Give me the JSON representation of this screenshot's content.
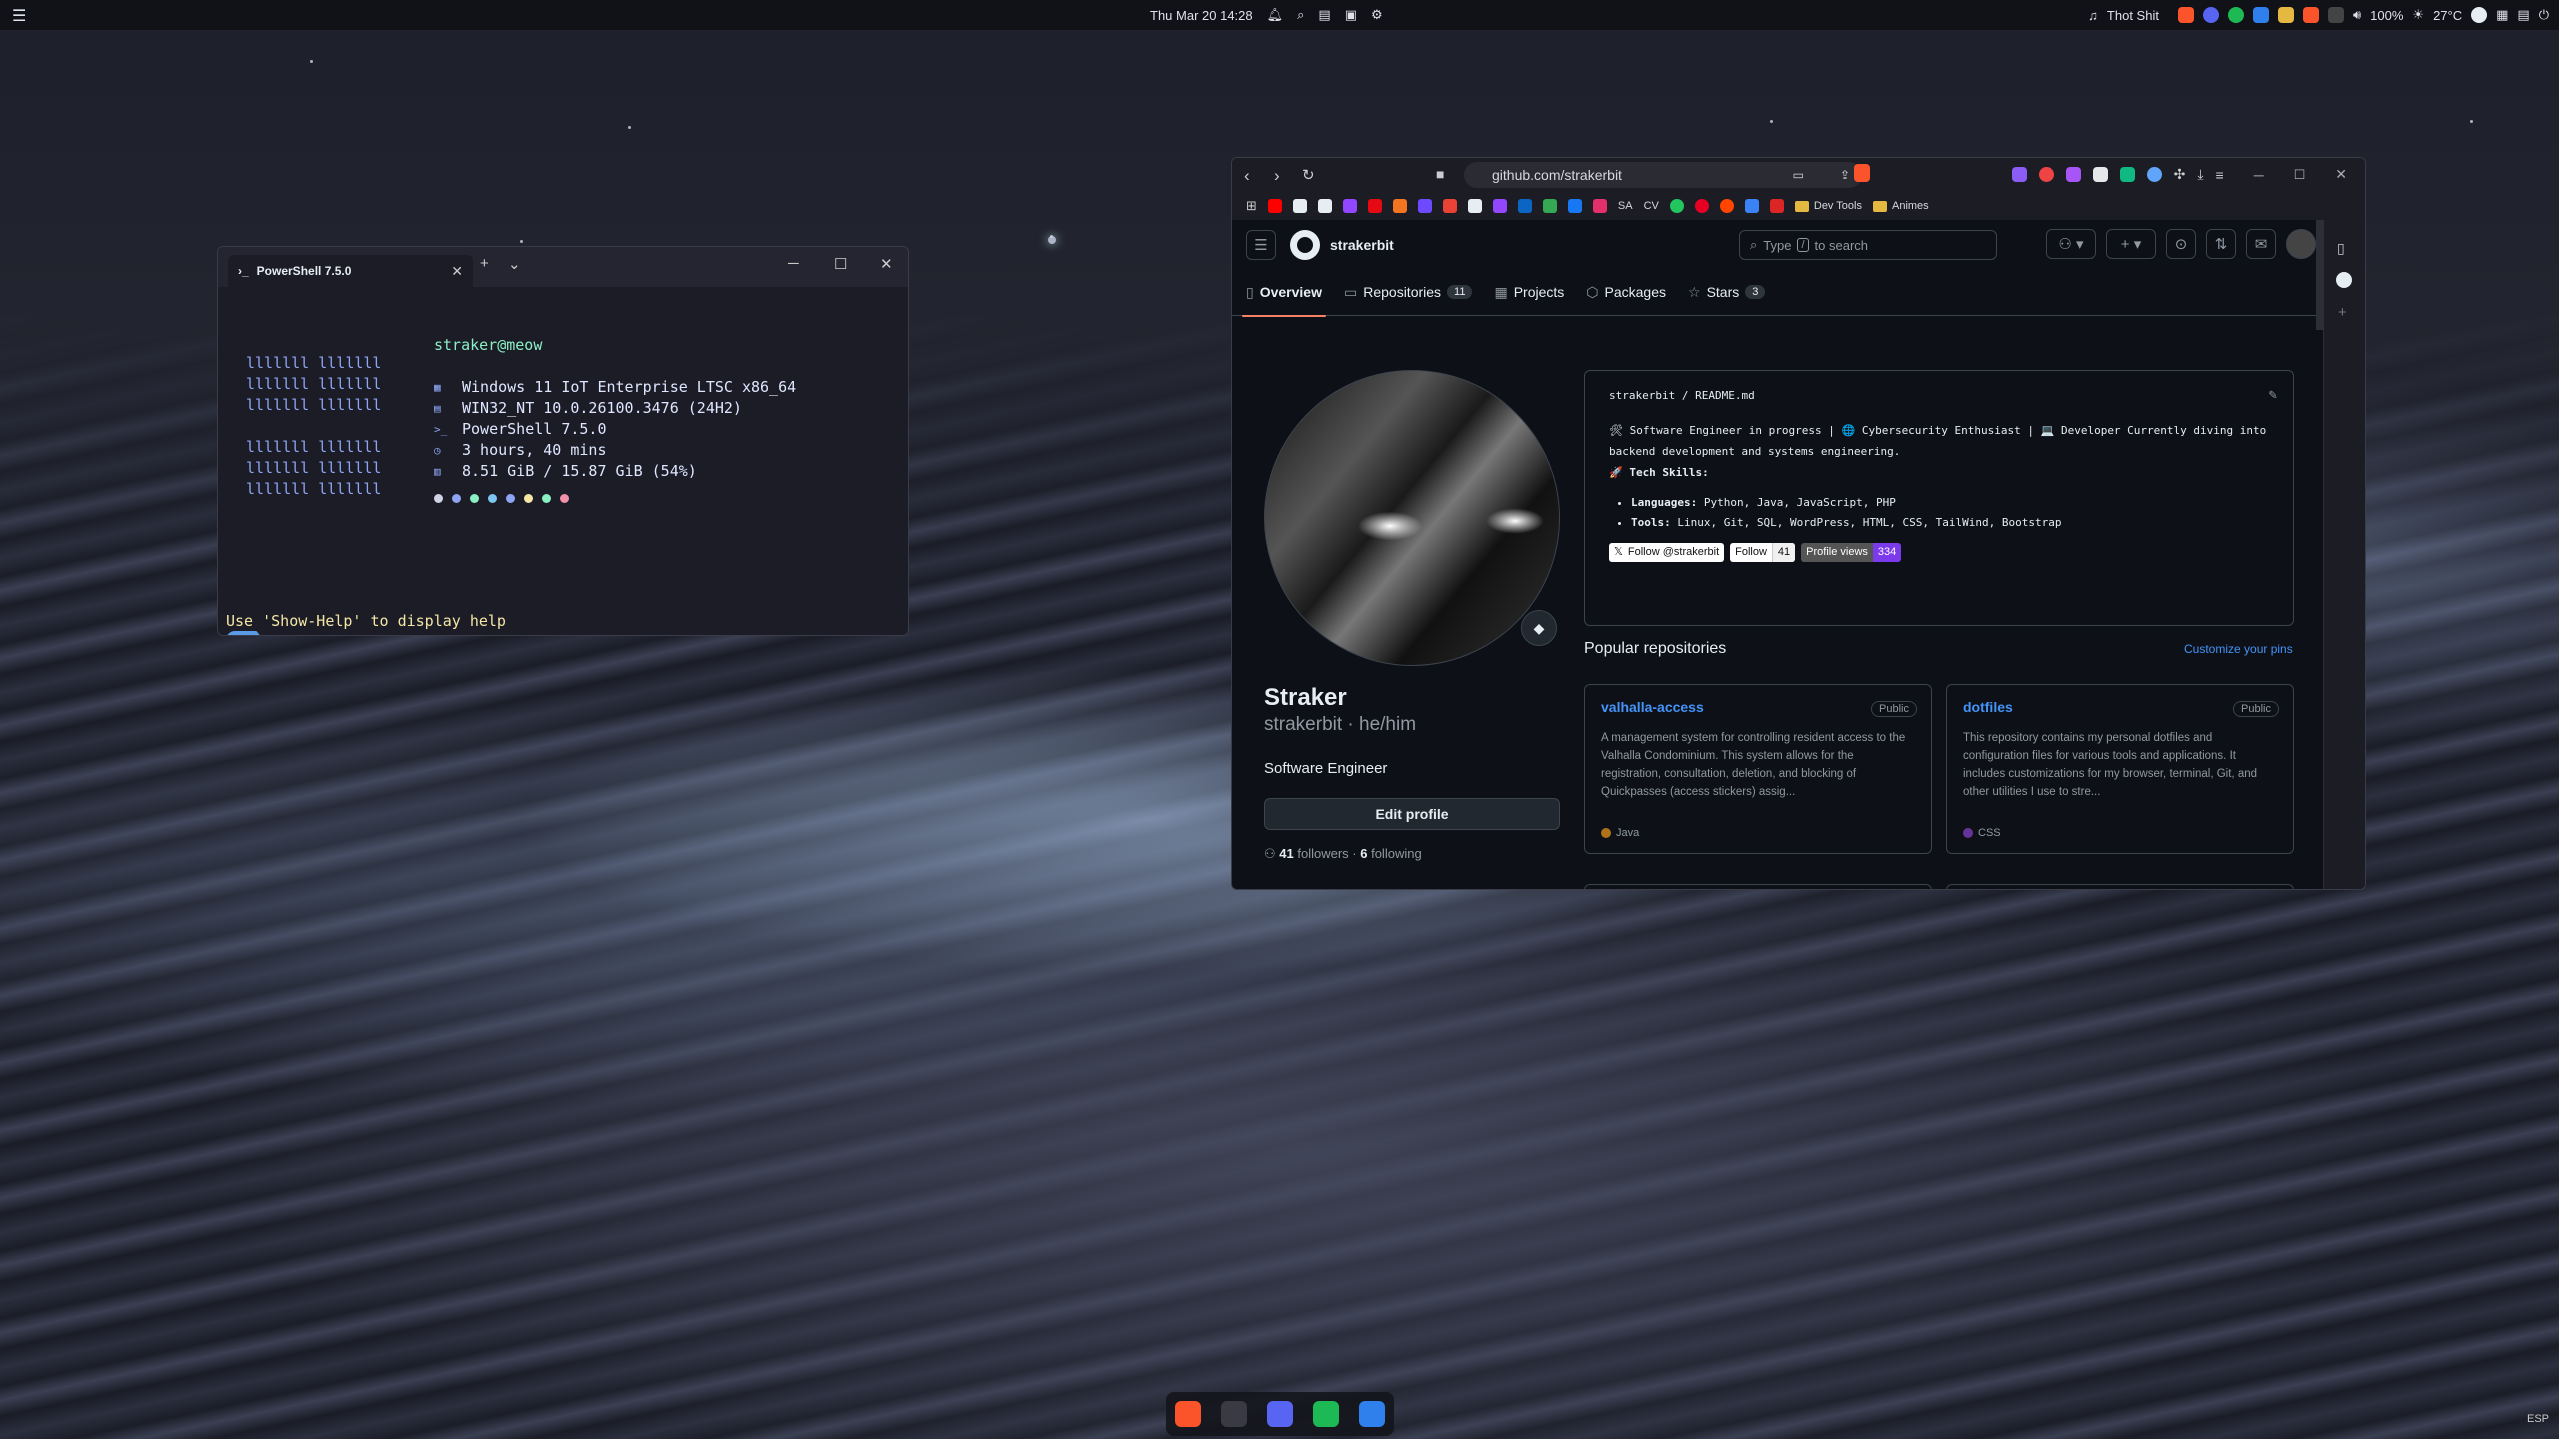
{
  "topbar": {
    "menu_icon": "hamburger-icon",
    "datetime": "Thu Mar 20 14:28",
    "now_playing": "Thot Shit",
    "volume": "100%",
    "weather": "27°C"
  },
  "terminal": {
    "tab_title": "PowerShell 7.5.0",
    "new_tab": "+",
    "dropdown": "⌄",
    "user_host": "straker@meow",
    "logo_lines": [
      "lllllll lllllll",
      "lllllll lllllll",
      "lllllll lllllll",
      "",
      "lllllll lllllll",
      "lllllll lllllll",
      "lllllll lllllll"
    ],
    "info": [
      {
        "icon": "windows-icon",
        "glyph": "▦",
        "text": "Windows 11 IoT Enterprise LTSC x86_64"
      },
      {
        "icon": "kernel-icon",
        "glyph": "▤",
        "text": "WIN32_NT 10.0.26100.3476 (24H2)"
      },
      {
        "icon": "shell-icon",
        "glyph": ">_",
        "text": "PowerShell 7.5.0"
      },
      {
        "icon": "clock-icon",
        "glyph": "◷",
        "text": "3 hours, 40 mins"
      },
      {
        "icon": "memory-icon",
        "glyph": "▥",
        "text": "8.51 GiB / 15.87 GiB (54%)"
      }
    ],
    "color_dots": [
      "#cfd3e6",
      "#8da4f2",
      "#8af0c4",
      "#7cc7f0",
      "#8da4f2",
      "#f5e6a6",
      "#8af0c4",
      "#f28fa9"
    ],
    "help_line": "Use 'Show-Help' to display help",
    "prompt": "~"
  },
  "browser": {
    "url": "github.com/strakerbit",
    "bookmarks": [
      {
        "name": "youtube",
        "color": "#ff0000"
      },
      {
        "name": "github",
        "color": "#e6edf3"
      },
      {
        "name": "x",
        "color": "#e6edf3"
      },
      {
        "name": "twitch",
        "color": "#9146ff"
      },
      {
        "name": "netflix",
        "color": "#e50914"
      },
      {
        "name": "crunchyroll",
        "color": "#f47521"
      },
      {
        "name": "proton",
        "color": "#6d4aff"
      },
      {
        "name": "gmail",
        "color": "#ea4335"
      },
      {
        "name": "amazon",
        "color": "#e6edf3"
      },
      {
        "name": "twitch2",
        "color": "#9146ff"
      },
      {
        "name": "linkedin",
        "color": "#0a66c2"
      },
      {
        "name": "drive",
        "color": "#34a853"
      },
      {
        "name": "facebook",
        "color": "#1877f2"
      },
      {
        "name": "instagram",
        "color": "#e1306c"
      }
    ],
    "bm_sa": "SA",
    "bm_cv": "CV",
    "folders": [
      "Dev Tools",
      "Animes"
    ]
  },
  "github": {
    "username": "strakerbit",
    "search_prefix": "Type",
    "search_key": "/",
    "search_suffix": "to search",
    "tabs": [
      {
        "label": "Overview",
        "count": ""
      },
      {
        "label": "Repositories",
        "count": "11"
      },
      {
        "label": "Projects",
        "count": ""
      },
      {
        "label": "Packages",
        "count": ""
      },
      {
        "label": "Stars",
        "count": "3"
      }
    ],
    "profile": {
      "name": "Straker",
      "login": "strakerbit · he/him",
      "bio": "Software Engineer",
      "edit_button": "Edit profile",
      "followers_count": "41",
      "followers_label": "followers",
      "following_count": "6",
      "following_label": "following"
    },
    "readme": {
      "path": "strakerbit / README.md",
      "line1": "🛠 Software Engineer in progress | 🌐 Cybersecurity Enthusiast | 💻 Developer Currently diving into",
      "line2": "backend development and systems engineering.",
      "skills_title": "🚀 Tech Skills:",
      "languages_label": "Languages:",
      "languages": "Python, Java, JavaScript, PHP",
      "tools_label": "Tools:",
      "tools": "Linux, Git, SQL, WordPress, HTML, CSS, TailWind, Bootstrap",
      "badge_x": "Follow @strakerbit",
      "badge_gh": "Follow",
      "badge_gh_count": "41",
      "badge_views": "Profile views",
      "badge_views_count": "334"
    },
    "popular_title": "Popular repositories",
    "customize": "Customize your pins",
    "repos": [
      {
        "name": "valhalla-access",
        "visibility": "Public",
        "desc": "A management system for controlling resident access to the Valhalla Condominium. This system allows for the registration, consultation, deletion, and blocking of Quickpasses (access stickers) assig...",
        "lang": "Java",
        "lang_color": "#b07219"
      },
      {
        "name": "dotfiles",
        "visibility": "Public",
        "desc": "This repository contains my personal dotfiles and configuration files for various tools and applications. It includes customizations for my browser, terminal, Git, and other utilities I use to stre...",
        "lang": "CSS",
        "lang_color": "#663399"
      }
    ]
  },
  "dock": [
    "brave",
    "terminal",
    "discord",
    "spotify",
    "vscode"
  ],
  "keyboard_layout": "ESP"
}
